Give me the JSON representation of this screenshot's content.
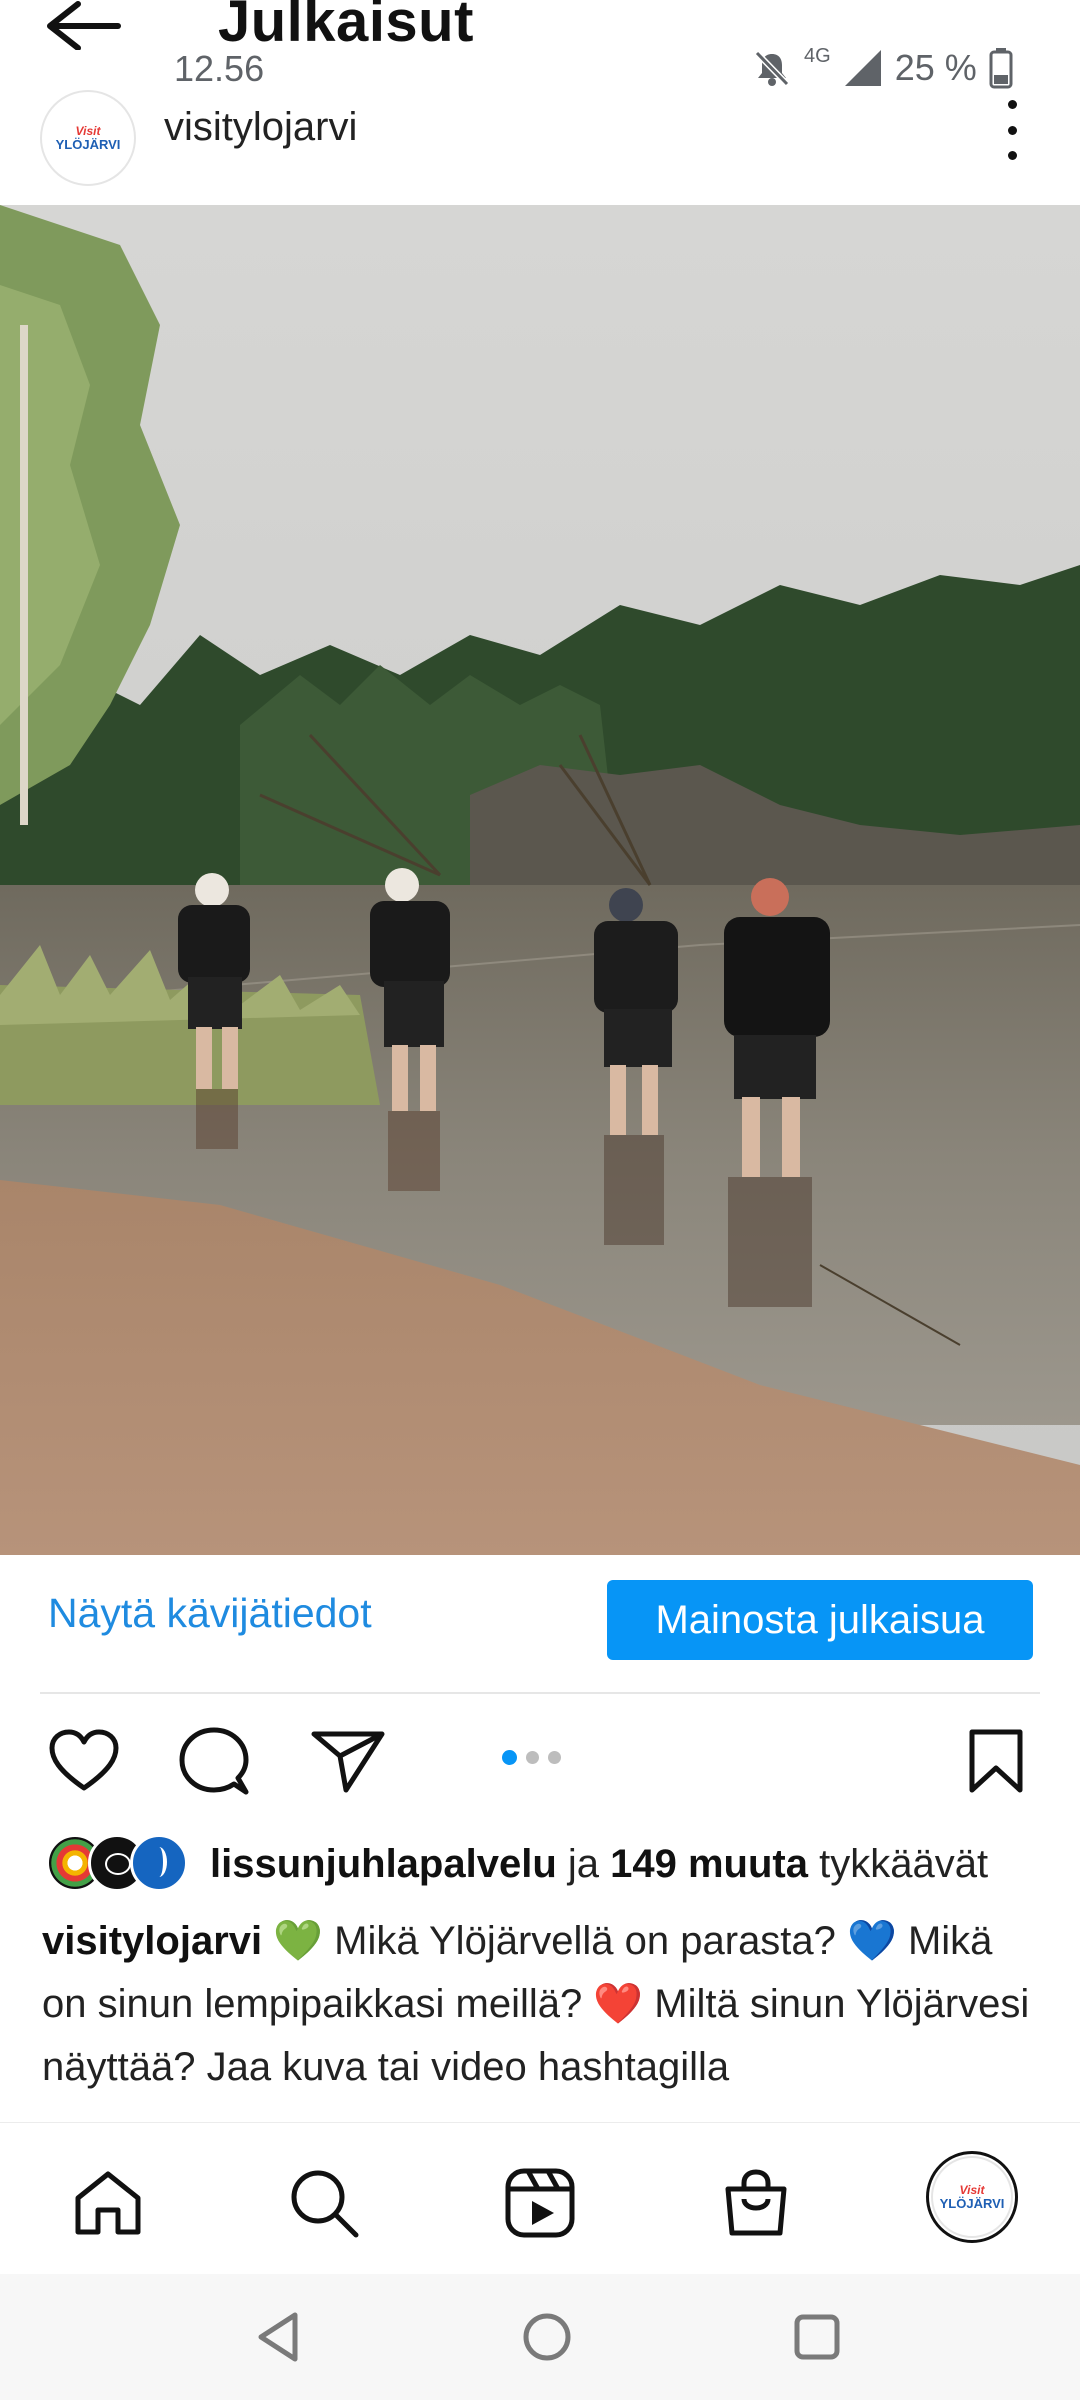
{
  "header": {
    "title": "Julkaisut",
    "back_icon": "arrow-left-icon"
  },
  "status_bar": {
    "time": "12.56",
    "network": "4G",
    "battery": "25 %",
    "icons": [
      "mute-notifications-icon",
      "signal-icon",
      "battery-icon"
    ]
  },
  "post": {
    "username": "visitylojarvi",
    "avatar_text": {
      "line1": "Visit",
      "line2": "YLÖJÄRVI"
    },
    "image_alt_icon": "photo-icon",
    "insights_label": "Näytä kävijätiedot",
    "promote_label": "Mainosta julkaisua",
    "carousel": {
      "count": 3,
      "active": 0
    },
    "likes": {
      "first_liker": "lissunjuhlapalvelu",
      "connector": " ja ",
      "others": "149 muuta",
      "suffix": " tykkäävät"
    },
    "caption": {
      "username": "visitylojarvi",
      "text": " 💚 Mikä Ylöjärvellä on parasta? 💙 Mikä on sinun lempipaikkasi meillä? ❤️ Miltä sinun Ylöjärvesi näyttää? Jaa kuva tai video hashtagilla"
    }
  },
  "bottom_nav": {
    "items": [
      "home-icon",
      "search-icon",
      "reels-icon",
      "shop-icon",
      "profile-avatar"
    ]
  },
  "colors": {
    "accent": "#0795f6",
    "link": "#1f8be0",
    "text": "#111111"
  }
}
